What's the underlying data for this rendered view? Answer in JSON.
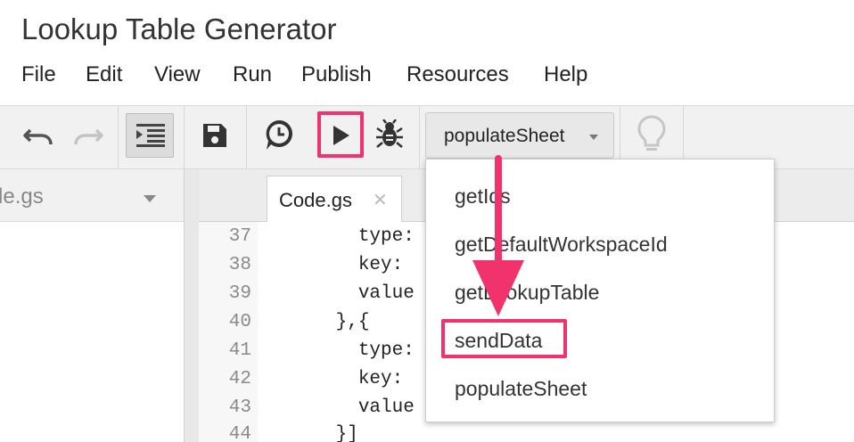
{
  "app": {
    "title": "Lookup Table Generator"
  },
  "menu": [
    "File",
    "Edit",
    "View",
    "Run",
    "Publish",
    "Resources",
    "Help"
  ],
  "toolbar": {
    "function_select": "populateSheet",
    "icons": [
      "undo-icon",
      "redo-icon",
      "indent-icon",
      "save-icon",
      "triggers-clock-icon",
      "run-icon",
      "debug-bug-icon",
      "lightbulb-icon"
    ]
  },
  "files": {
    "current": "de.gs"
  },
  "editor": {
    "tab": {
      "label": "Code.gs",
      "close": "✕"
    },
    "lines": [
      {
        "num": "37",
        "code": "        type:"
      },
      {
        "num": "38",
        "code": "        key:"
      },
      {
        "num": "39",
        "code": "        value"
      },
      {
        "num": "40",
        "code": "      },{"
      },
      {
        "num": "41",
        "code": "        type:"
      },
      {
        "num": "42",
        "code": "        key:"
      },
      {
        "num": "43",
        "code": "        value"
      },
      {
        "num": "44",
        "code": "      }]"
      }
    ]
  },
  "dropdown": {
    "items": [
      "getIds",
      "getDefaultWorkspaceId",
      "getLookupTable",
      "sendData",
      "populateSheet"
    ],
    "highlighted": "sendData"
  },
  "colors": {
    "accent": "#f0336d",
    "toolbar_bg": "#f1f1f1"
  }
}
